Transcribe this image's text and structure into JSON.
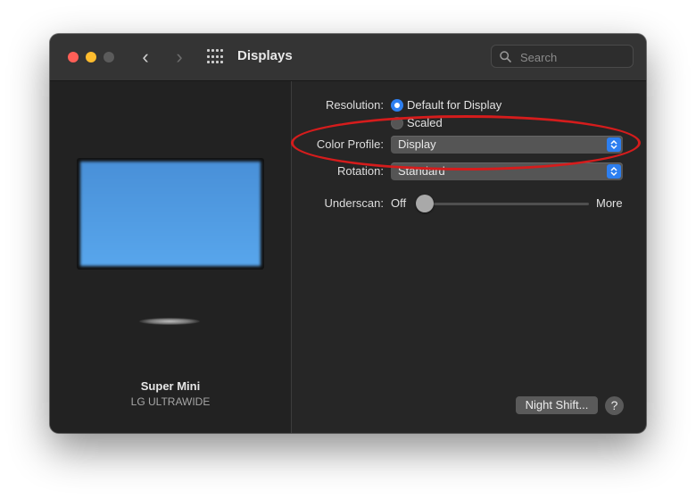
{
  "window": {
    "title": "Displays",
    "traffic_lights": {
      "close_color": "#ff5f57",
      "minimize_color": "#febc2e",
      "zoom_color": "#5b5b5b"
    },
    "nav_back_icon": "chevron-left-icon",
    "nav_forward_icon": "chevron-right-icon",
    "grid_icon": "grid-icon",
    "back_glyph": "‹",
    "forward_glyph": "›"
  },
  "search": {
    "placeholder": "Search",
    "value": "",
    "icon": "search-icon"
  },
  "sidebar": {
    "display_name": "Super Mini",
    "display_model": "LG ULTRAWIDE"
  },
  "settings": {
    "resolution": {
      "label": "Resolution:",
      "options": [
        {
          "label": "Default for Display",
          "selected": true
        },
        {
          "label": "Scaled",
          "selected": false
        }
      ]
    },
    "color_profile": {
      "label": "Color Profile:",
      "value": "Display"
    },
    "rotation": {
      "label": "Rotation:",
      "value": "Standard"
    },
    "underscan": {
      "label": "Underscan:",
      "min_label": "Off",
      "max_label": "More",
      "value": 0
    }
  },
  "buttons": {
    "night_shift": "Night Shift...",
    "help": "?"
  },
  "colors": {
    "accent": "#2d7ff0",
    "annotation": "#d51c1c"
  }
}
